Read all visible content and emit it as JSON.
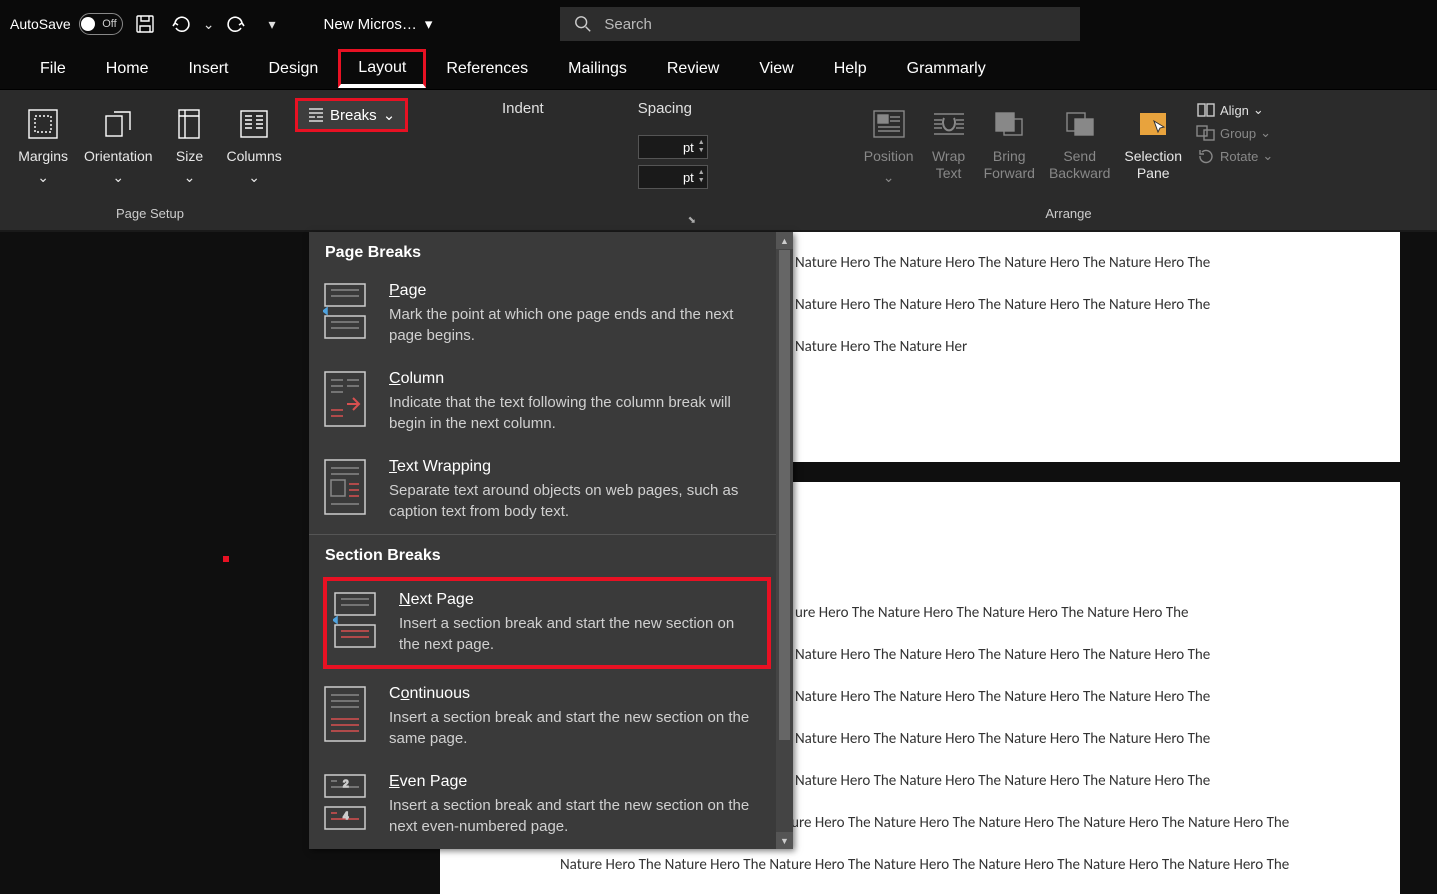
{
  "title_bar": {
    "autosave_label": "AutoSave",
    "autosave_state": "Off",
    "doc_name": "New Micros…"
  },
  "search": {
    "placeholder": "Search"
  },
  "tabs": {
    "file": "File",
    "home": "Home",
    "insert": "Insert",
    "design": "Design",
    "layout": "Layout",
    "references": "References",
    "mailings": "Mailings",
    "review": "Review",
    "view": "View",
    "help": "Help",
    "grammarly": "Grammarly"
  },
  "page_setup": {
    "margins": "Margins",
    "orientation": "Orientation",
    "size": "Size",
    "columns": "Columns",
    "breaks": "Breaks",
    "group_label": "Page Setup"
  },
  "paragraph": {
    "indent_label": "Indent",
    "spacing_label": "Spacing",
    "before_unit": "pt",
    "after_unit": "pt"
  },
  "arrange": {
    "position": "Position",
    "wrap_text": "Wrap\nText",
    "bring_forward": "Bring\nForward",
    "send_backward": "Send\nBackward",
    "selection_pane": "Selection\nPane",
    "align": "Align",
    "group": "Group",
    "rotate": "Rotate",
    "group_label": "Arrange"
  },
  "breaks_menu": {
    "section1": "Page Breaks",
    "page": {
      "title": "Page",
      "desc": "Mark the point at which one page ends and the next page begins."
    },
    "column": {
      "title": "Column",
      "desc": "Indicate that the text following the column break will begin in the next column."
    },
    "wrap": {
      "title": "Text Wrapping",
      "desc": "Separate text around objects on web pages, such as caption text from body text."
    },
    "section2": "Section Breaks",
    "next": {
      "title": "Next Page",
      "desc": "Insert a section break and start the new section on the next page."
    },
    "cont": {
      "title": "Continuous",
      "desc": "Insert a section break and start the new section on the same page."
    },
    "even": {
      "title": "Even Page",
      "desc": "Insert a section break and start the new section on the next even-numbered page."
    }
  },
  "chevron": "⌄",
  "doc": {
    "line1": "Nature Hero The Nature Hero The Nature Hero The Nature Hero The",
    "line2": "Nature Hero The Nature Hero The Nature Hero The Nature Hero The",
    "line3": "Nature Hero The Nature Her",
    "p2l1": "ure Hero The Nature Hero The Nature Hero The Nature Hero The",
    "p2l": "Nature Hero The Nature Hero The Nature Hero The Nature Hero The",
    "p2long": "Nature Hero The Nature Hero The Nature Hero The Nature Hero The Nature Hero The Nature Hero The Nature Hero The"
  }
}
